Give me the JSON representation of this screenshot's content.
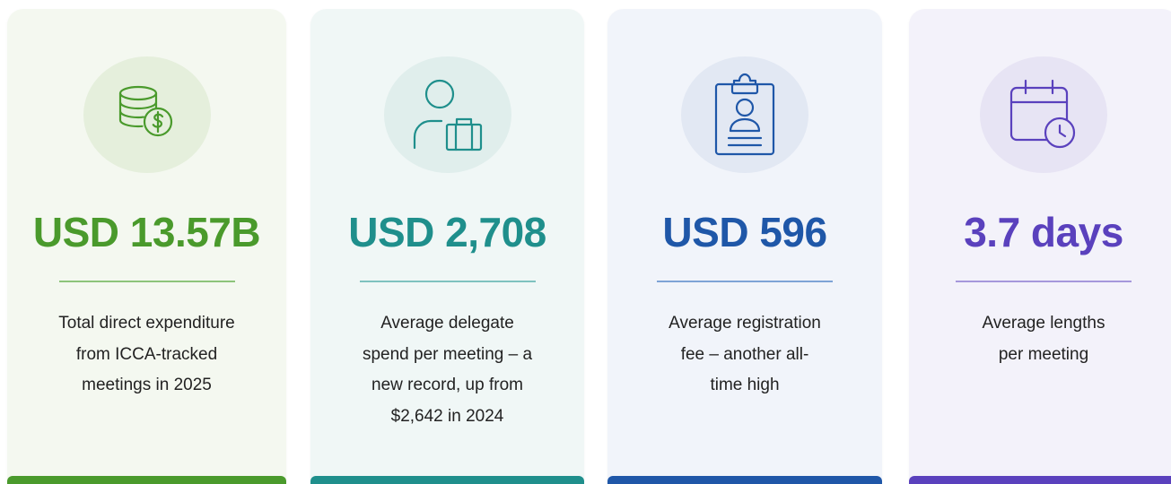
{
  "cards": [
    {
      "value": "USD 13.57B",
      "icon": "coin-stack-dollar-icon",
      "accent": "#4a9a2c",
      "description_lines": [
        "Total direct expenditure",
        "from ICCA-tracked",
        "meetings in 2025"
      ]
    },
    {
      "value": "USD 2,708",
      "icon": "person-briefcase-icon",
      "accent": "#1f8f8c",
      "description_lines": [
        "Average delegate",
        "spend per meeting – a",
        "new record, up from",
        "$2,642 in 2024"
      ]
    },
    {
      "value": "USD 596",
      "icon": "clipboard-badge-icon",
      "accent": "#1f57a8",
      "description_lines": [
        "Average registration",
        "fee – another all-",
        "time high"
      ]
    },
    {
      "value": "3.7 days",
      "icon": "calendar-clock-icon",
      "accent": "#5a41bd",
      "description_lines": [
        "Average lengths",
        "per meeting"
      ]
    }
  ]
}
